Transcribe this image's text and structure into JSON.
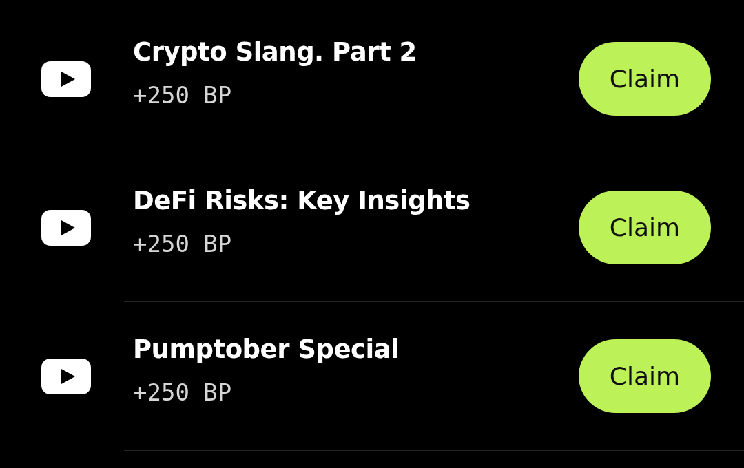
{
  "tasks": [
    {
      "kind": "video",
      "title": "Crypto Slang. Part 2",
      "reward": "+250 BP",
      "button": "Claim"
    },
    {
      "kind": "video",
      "title": "DeFi Risks: Key Insights",
      "reward": "+250 BP",
      "button": "Claim"
    },
    {
      "kind": "video",
      "title": "Pumptober Special",
      "reward": "+250 BP",
      "button": "Claim"
    }
  ]
}
